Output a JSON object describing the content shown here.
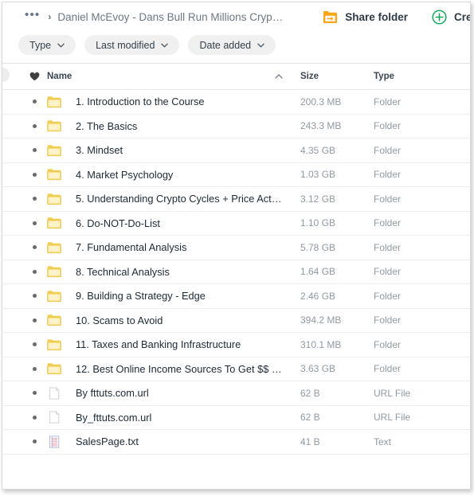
{
  "window": {
    "accent_green": "#14a85c",
    "accent_orange": "#faa61a",
    "folder_yellow": "#f7d154"
  },
  "breadcrumb": {
    "ellipsis": "•••",
    "separator": "›",
    "title": "Daniel McEvoy - Dans Bull Run Millions Cryp…"
  },
  "toolbar": {
    "share_folder_label": "Share folder",
    "share_folder_icon": "share-folder-icon",
    "create_folder_label": "Create fo",
    "create_folder_icon": "plus-circle-icon"
  },
  "filters": [
    {
      "label": "Type",
      "icon": "chevron-down-icon"
    },
    {
      "label": "Last modified",
      "icon": "chevron-down-icon"
    },
    {
      "label": "Date added",
      "icon": "chevron-down-icon"
    }
  ],
  "table": {
    "headers": {
      "favorite": "heart-icon",
      "name": "Name",
      "sort_indicator": "chevron-up-icon",
      "size": "Size",
      "type": "Type"
    },
    "rows": [
      {
        "icon": "folder-icon",
        "name": "1. Introduction to the Course",
        "size": "200.3 MB",
        "type": "Folder"
      },
      {
        "icon": "folder-icon",
        "name": "2. The Basics",
        "size": "243.3 MB",
        "type": "Folder"
      },
      {
        "icon": "folder-icon",
        "name": "3. Mindset",
        "size": "4.35 GB",
        "type": "Folder"
      },
      {
        "icon": "folder-icon",
        "name": "4. Market Psychology",
        "size": "1.03 GB",
        "type": "Folder"
      },
      {
        "icon": "folder-icon",
        "name": "5. Understanding Crypto Cycles + Price Act…",
        "size": "3.12 GB",
        "type": "Folder"
      },
      {
        "icon": "folder-icon",
        "name": "6. Do-NOT-Do-List",
        "size": "1.10 GB",
        "type": "Folder"
      },
      {
        "icon": "folder-icon",
        "name": "7. Fundamental Analysis",
        "size": "5.78 GB",
        "type": "Folder"
      },
      {
        "icon": "folder-icon",
        "name": "8. Technical Analysis",
        "size": "1.64 GB",
        "type": "Folder"
      },
      {
        "icon": "folder-icon",
        "name": "9. Building a Strategy - Edge",
        "size": "2.46 GB",
        "type": "Folder"
      },
      {
        "icon": "folder-icon",
        "name": "10. Scams to Avoid",
        "size": "394.2 MB",
        "type": "Folder"
      },
      {
        "icon": "folder-icon",
        "name": "11. Taxes and Banking Infrastructure",
        "size": "310.1 MB",
        "type": "Folder"
      },
      {
        "icon": "folder-icon",
        "name": "12. Best Online Income Sources To Get $$ …",
        "size": "3.63 GB",
        "type": "Folder"
      },
      {
        "icon": "url-file-icon",
        "name": "By fttuts.com.url",
        "size": "62 B",
        "type": "URL File"
      },
      {
        "icon": "url-file-icon",
        "name": "By_fttuts.com.url",
        "size": "62 B",
        "type": "URL File"
      },
      {
        "icon": "text-file-icon",
        "name": "SalesPage.txt",
        "size": "41 B",
        "type": "Text"
      }
    ]
  }
}
